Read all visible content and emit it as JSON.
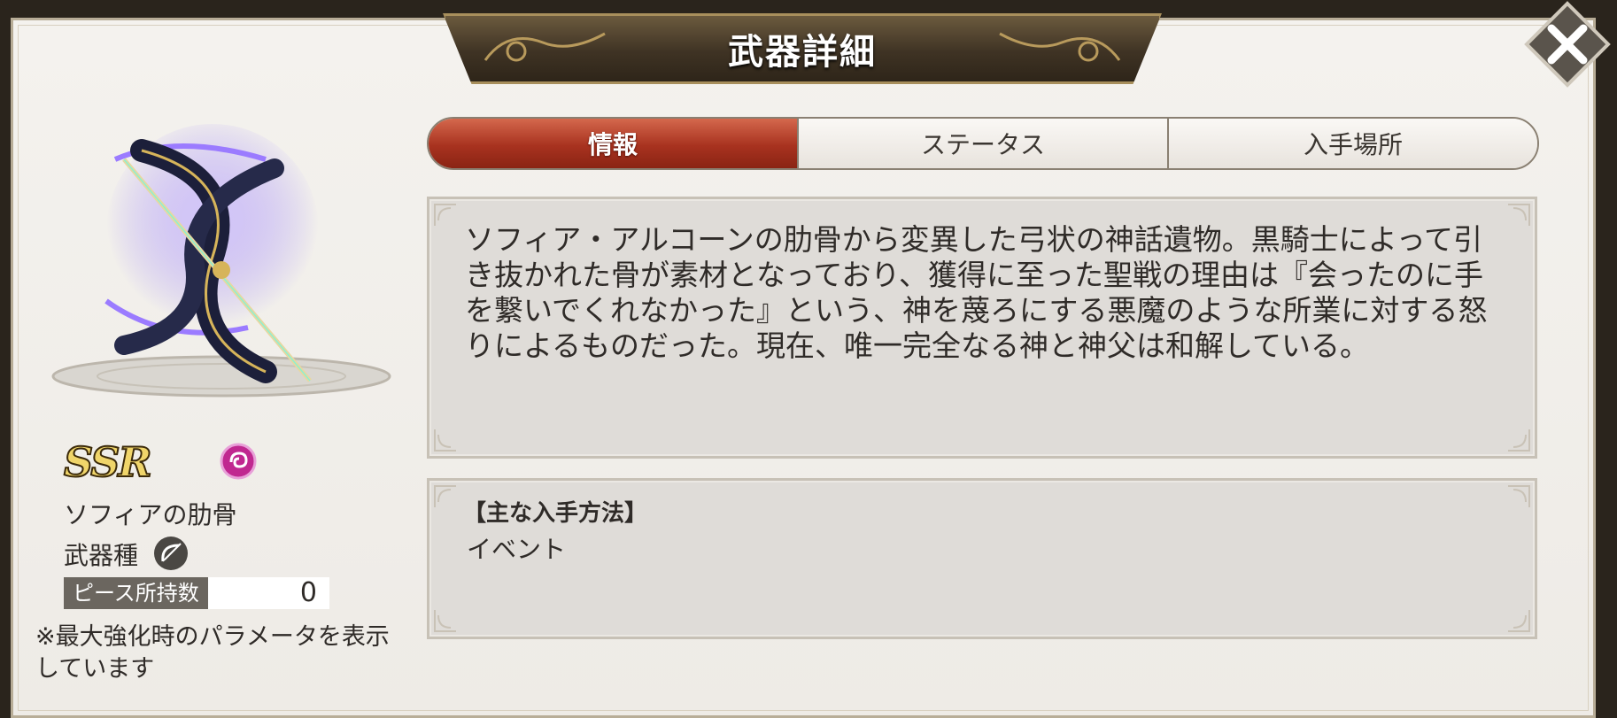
{
  "dialog": {
    "title": "武器詳細",
    "close_icon": "close-x-icon"
  },
  "tabs": [
    {
      "label": "情報",
      "active": true
    },
    {
      "label": "ステータス",
      "active": false
    },
    {
      "label": "入手場所",
      "active": false
    }
  ],
  "weapon": {
    "rarity": "SSR",
    "element_icon": "dark-element-icon",
    "name": "ソフィアの肋骨",
    "type_label": "武器種",
    "type_icon": "bow-icon",
    "piece_label": "ピース所持数",
    "piece_count": "0",
    "note": "※最大強化時のパラメータを表示しています"
  },
  "description": "ソフィア・アルコーンの肋骨から変異した弓状の神話遺物。黒騎士によって引き抜かれた骨が素材となっており、獲得に至った聖戦の理由は『会ったのに手を繋いでくれなかった』という、神を蔑ろにする悪魔のような所業に対する怒りによるものだった。現在、唯一完全なる神と神父は和解している。",
  "acquisition": {
    "heading": "【主な入手方法】",
    "items": [
      "イベント"
    ]
  },
  "colors": {
    "active_tab": "#b8402a",
    "title_plate": "#3f3324",
    "rarity_gold": "#f0d56a",
    "element_dark": "#c02890"
  }
}
